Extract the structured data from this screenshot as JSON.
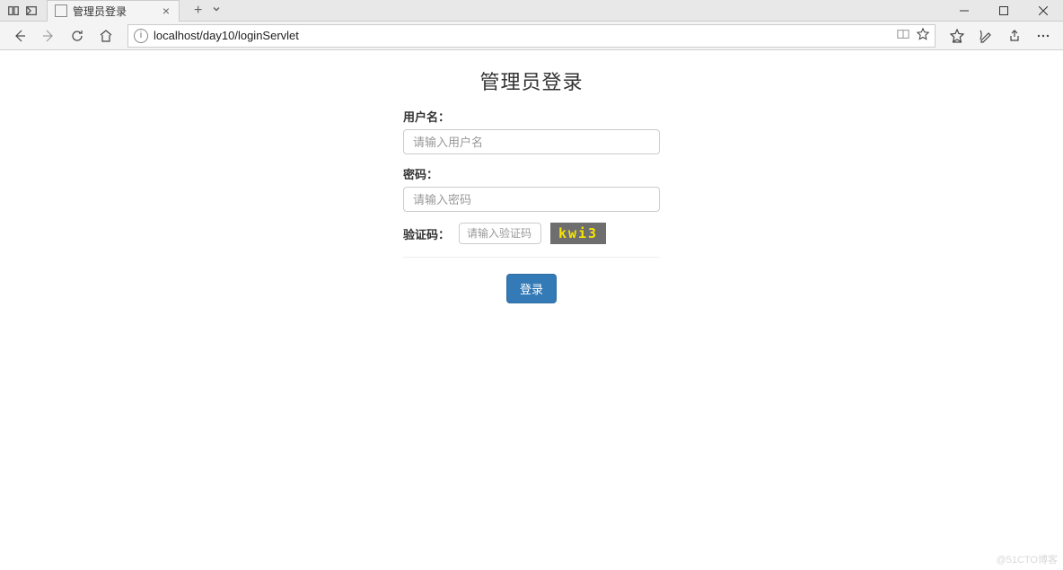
{
  "browser": {
    "tab_title": "管理员登录",
    "url": "localhost/day10/loginServlet"
  },
  "page": {
    "title": "管理员登录",
    "username_label": "用户名：",
    "username_placeholder": "请输入用户名",
    "password_label": "密码：",
    "password_placeholder": "请输入密码",
    "captcha_label": "验证码：",
    "captcha_placeholder": "请输入验证码",
    "captcha_value": "kwi3",
    "login_button": "登录"
  },
  "watermark": "@51CTO博客"
}
